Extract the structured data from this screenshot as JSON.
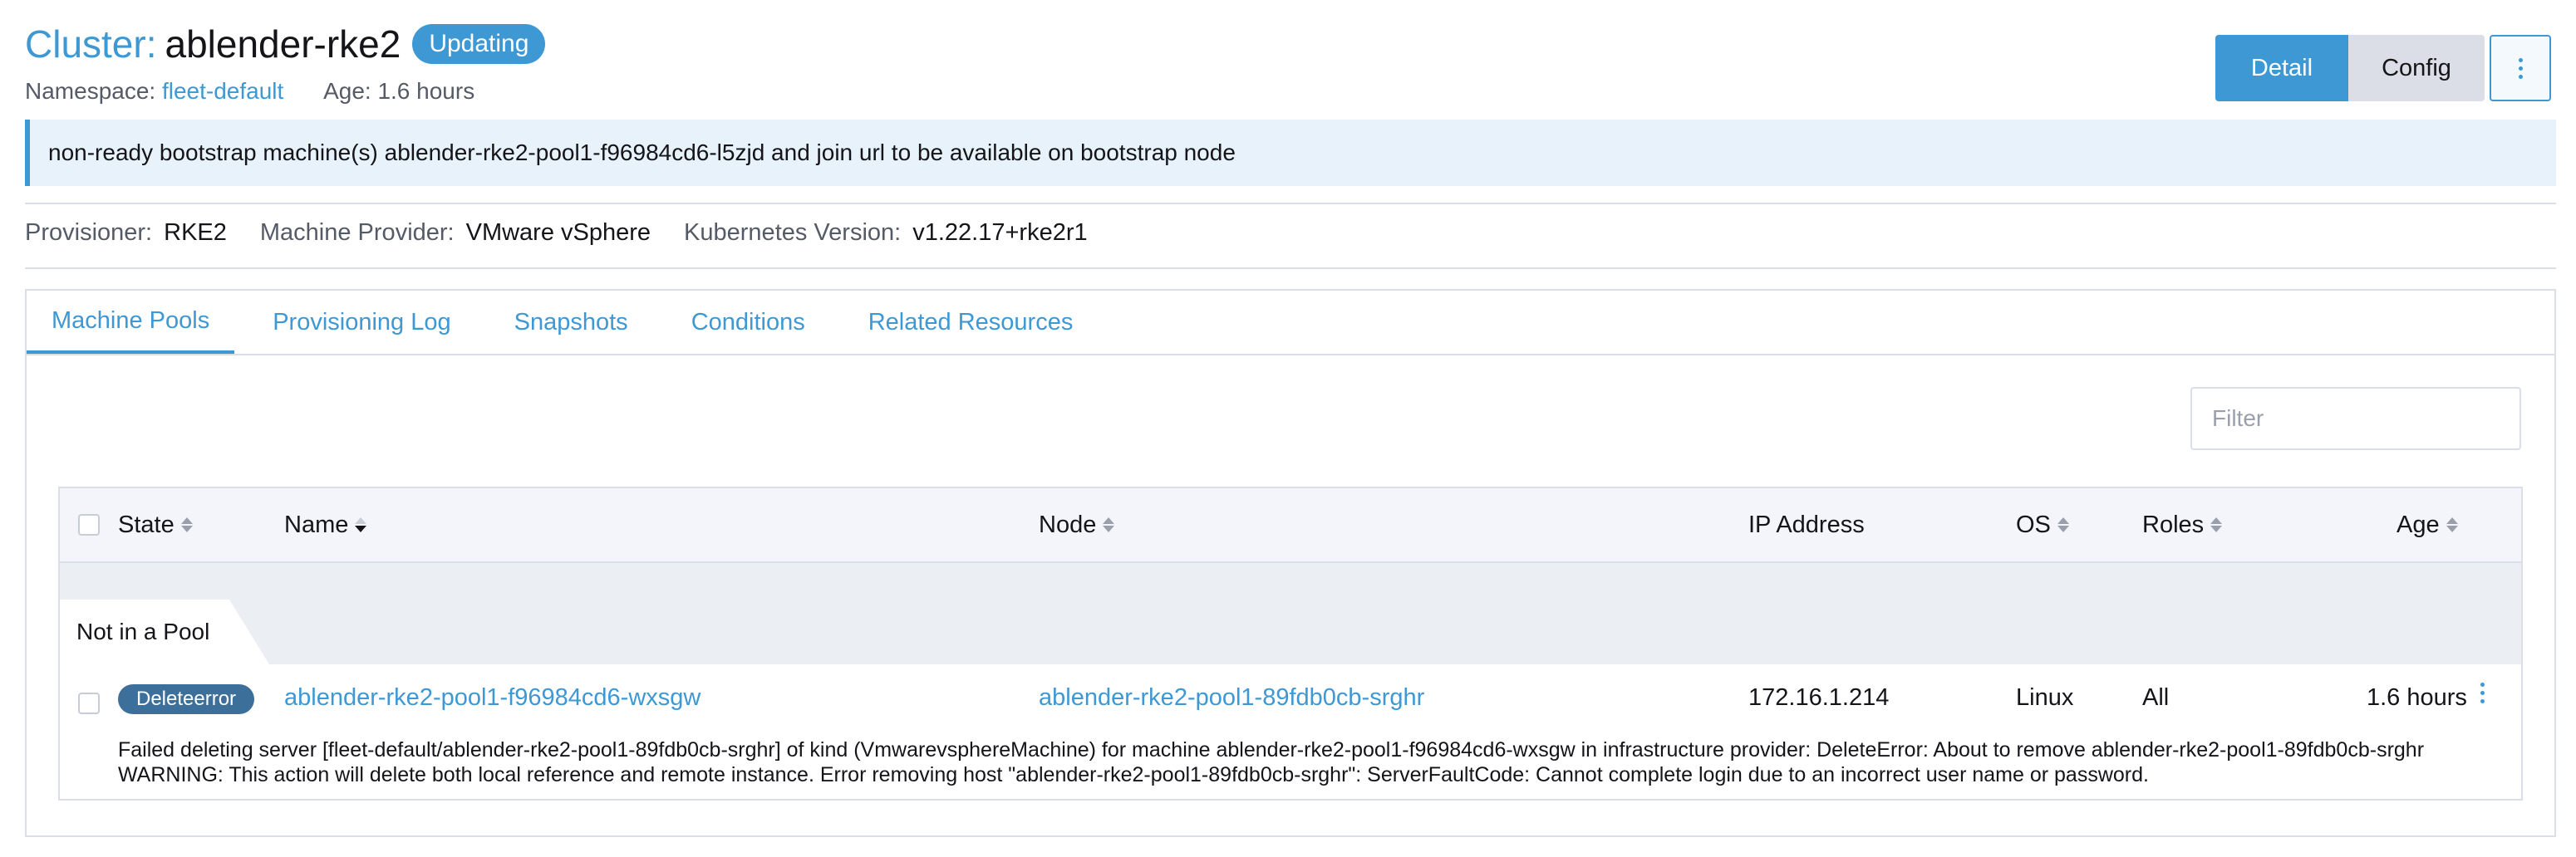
{
  "header": {
    "title_prefix": "Cluster:",
    "cluster_name": "ablender-rke2",
    "status_badge": "Updating",
    "namespace_label": "Namespace:",
    "namespace_value": "fleet-default",
    "age_text": "Age: 1.6 hours"
  },
  "actions": {
    "detail_label": "Detail",
    "config_label": "Config",
    "more_icon": "vertical-dots-icon"
  },
  "banner": {
    "message": "non-ready bootstrap machine(s) ablender-rke2-pool1-f96984cd6-l5zjd and join url to be available on bootstrap node"
  },
  "info": {
    "provisioner_label": "Provisioner:",
    "provisioner_value": "RKE2",
    "machine_provider_label": "Machine Provider:",
    "machine_provider_value": "VMware vSphere",
    "k8s_version_label": "Kubernetes Version:",
    "k8s_version_value": "v1.22.17+rke2r1"
  },
  "tabs": [
    {
      "label": "Machine Pools",
      "active": true
    },
    {
      "label": "Provisioning Log",
      "active": false
    },
    {
      "label": "Snapshots",
      "active": false
    },
    {
      "label": "Conditions",
      "active": false
    },
    {
      "label": "Related Resources",
      "active": false
    }
  ],
  "filter": {
    "placeholder": "Filter"
  },
  "table": {
    "columns": {
      "state": "State",
      "name": "Name",
      "node": "Node",
      "ip": "IP Address",
      "os": "OS",
      "roles": "Roles",
      "age": "Age"
    },
    "group_label": "Not in a Pool",
    "rows": [
      {
        "state": "Deleteerror",
        "name": "ablender-rke2-pool1-f96984cd6-wxsgw",
        "node": "ablender-rke2-pool1-89fdb0cb-srghr",
        "ip": "172.16.1.214",
        "os": "Linux",
        "roles": "All",
        "age": "1.6 hours",
        "message": "Failed deleting server [fleet-default/ablender-rke2-pool1-89fdb0cb-srghr] of kind (VmwarevsphereMachine) for machine ablender-rke2-pool1-f96984cd6-wxsgw in infrastructure provider: DeleteError: About to remove ablender-rke2-pool1-89fdb0cb-srghr WARNING: This action will delete both local reference and remote instance. Error removing host \"ablender-rke2-pool1-89fdb0cb-srghr\": ServerFaultCode: Cannot complete login due to an incorrect user name or password."
      }
    ]
  },
  "colors": {
    "accent": "#3d98d3",
    "badge_error": "#3d6f9b",
    "banner_bg": "#e8f2fa"
  }
}
